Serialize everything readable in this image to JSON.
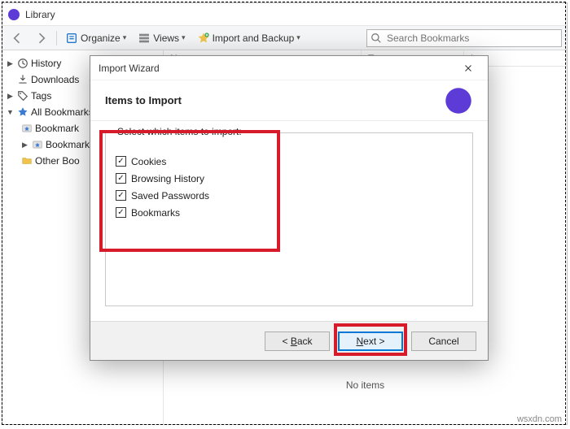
{
  "library": {
    "title": "Library",
    "toolbar": {
      "organize": "Organize",
      "views": "Views",
      "import_backup": "Import and Backup"
    },
    "search": {
      "placeholder": "Search Bookmarks"
    },
    "tree": {
      "history": "History",
      "downloads": "Downloads",
      "tags": "Tags",
      "all_bookmarks": "All Bookmarks",
      "toolbar": "Bookmark",
      "menu": "Bookmark",
      "other": "Other Boo"
    },
    "columns": {
      "name": "N",
      "tags": "T",
      "location": "L"
    },
    "status_empty": "No items"
  },
  "wizard": {
    "window_title": "Import Wizard",
    "heading": "Items to Import",
    "legend": "Select which items to import:",
    "items": [
      "Cookies",
      "Browsing History",
      "Saved Passwords",
      "Bookmarks"
    ],
    "buttons": {
      "back": "< Back",
      "next": "Next >",
      "cancel": "Cancel"
    },
    "mnemonic": {
      "back": "B",
      "next": "N"
    }
  },
  "watermark": "wsxdn.com"
}
